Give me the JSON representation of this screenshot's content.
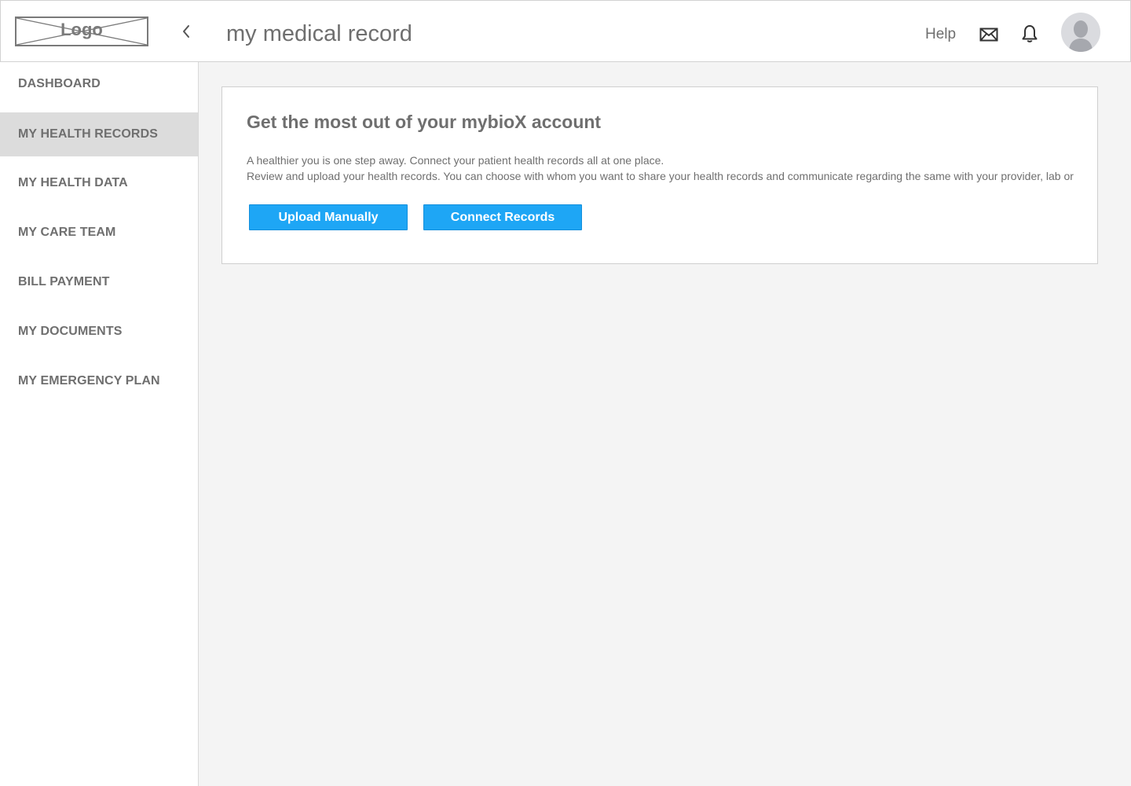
{
  "header": {
    "logo_text": "Logo",
    "title": "my medical record",
    "help_label": "Help"
  },
  "icons": {
    "back": "chevron-left-icon",
    "mail": "mail-icon",
    "bell": "bell-icon",
    "avatar": "user-avatar"
  },
  "sidebar": {
    "items": [
      {
        "label": "DASHBOARD",
        "active": false
      },
      {
        "label": "MY HEALTH RECORDS",
        "active": true
      },
      {
        "label": "MY HEALTH DATA",
        "active": false
      },
      {
        "label": "MY CARE TEAM",
        "active": false
      },
      {
        "label": "BILL PAYMENT",
        "active": false
      },
      {
        "label": "MY DOCUMENTS",
        "active": false
      },
      {
        "label": "MY EMERGENCY PLAN",
        "active": false
      }
    ]
  },
  "card": {
    "title": "Get the most out of your mybioX account",
    "line1": "A healthier you is one step away. Connect your patient health records all at one place.",
    "line2": "Review and upload your health records. You can choose with whom you want to share your health records and communicate regarding the same with your provider, lab or",
    "upload_button": "Upload Manually",
    "connect_button": "Connect Records"
  },
  "colors": {
    "accent": "#1ea6f5",
    "active_nav_bg": "#dcdcdc",
    "page_bg": "#f4f4f4",
    "text": "#6f6f6f"
  }
}
